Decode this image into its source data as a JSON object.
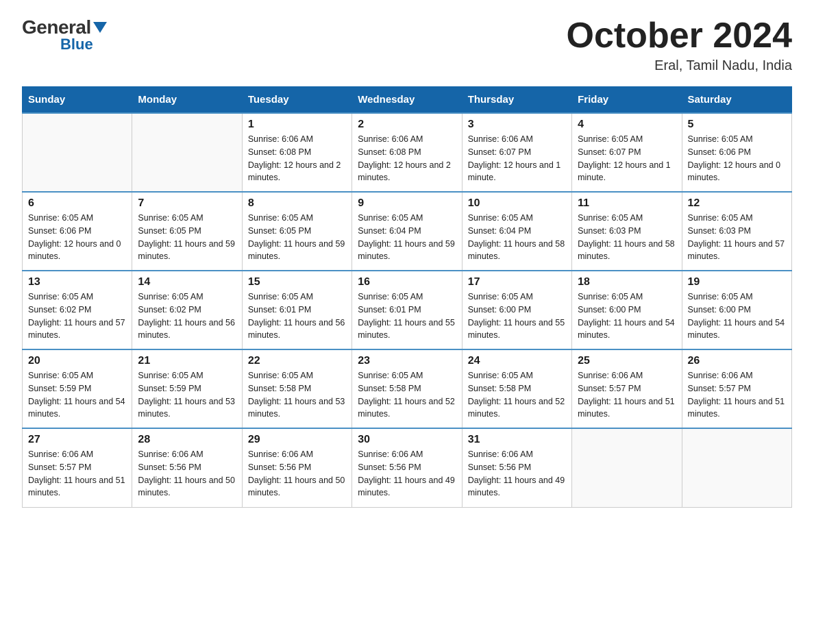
{
  "logo": {
    "general": "General",
    "blue": "Blue",
    "triangle": "▼"
  },
  "header": {
    "title": "October 2024",
    "subtitle": "Eral, Tamil Nadu, India"
  },
  "days_of_week": [
    "Sunday",
    "Monday",
    "Tuesday",
    "Wednesday",
    "Thursday",
    "Friday",
    "Saturday"
  ],
  "weeks": [
    [
      {
        "day": "",
        "sunrise": "",
        "sunset": "",
        "daylight": ""
      },
      {
        "day": "",
        "sunrise": "",
        "sunset": "",
        "daylight": ""
      },
      {
        "day": "1",
        "sunrise": "Sunrise: 6:06 AM",
        "sunset": "Sunset: 6:08 PM",
        "daylight": "Daylight: 12 hours and 2 minutes."
      },
      {
        "day": "2",
        "sunrise": "Sunrise: 6:06 AM",
        "sunset": "Sunset: 6:08 PM",
        "daylight": "Daylight: 12 hours and 2 minutes."
      },
      {
        "day": "3",
        "sunrise": "Sunrise: 6:06 AM",
        "sunset": "Sunset: 6:07 PM",
        "daylight": "Daylight: 12 hours and 1 minute."
      },
      {
        "day": "4",
        "sunrise": "Sunrise: 6:05 AM",
        "sunset": "Sunset: 6:07 PM",
        "daylight": "Daylight: 12 hours and 1 minute."
      },
      {
        "day": "5",
        "sunrise": "Sunrise: 6:05 AM",
        "sunset": "Sunset: 6:06 PM",
        "daylight": "Daylight: 12 hours and 0 minutes."
      }
    ],
    [
      {
        "day": "6",
        "sunrise": "Sunrise: 6:05 AM",
        "sunset": "Sunset: 6:06 PM",
        "daylight": "Daylight: 12 hours and 0 minutes."
      },
      {
        "day": "7",
        "sunrise": "Sunrise: 6:05 AM",
        "sunset": "Sunset: 6:05 PM",
        "daylight": "Daylight: 11 hours and 59 minutes."
      },
      {
        "day": "8",
        "sunrise": "Sunrise: 6:05 AM",
        "sunset": "Sunset: 6:05 PM",
        "daylight": "Daylight: 11 hours and 59 minutes."
      },
      {
        "day": "9",
        "sunrise": "Sunrise: 6:05 AM",
        "sunset": "Sunset: 6:04 PM",
        "daylight": "Daylight: 11 hours and 59 minutes."
      },
      {
        "day": "10",
        "sunrise": "Sunrise: 6:05 AM",
        "sunset": "Sunset: 6:04 PM",
        "daylight": "Daylight: 11 hours and 58 minutes."
      },
      {
        "day": "11",
        "sunrise": "Sunrise: 6:05 AM",
        "sunset": "Sunset: 6:03 PM",
        "daylight": "Daylight: 11 hours and 58 minutes."
      },
      {
        "day": "12",
        "sunrise": "Sunrise: 6:05 AM",
        "sunset": "Sunset: 6:03 PM",
        "daylight": "Daylight: 11 hours and 57 minutes."
      }
    ],
    [
      {
        "day": "13",
        "sunrise": "Sunrise: 6:05 AM",
        "sunset": "Sunset: 6:02 PM",
        "daylight": "Daylight: 11 hours and 57 minutes."
      },
      {
        "day": "14",
        "sunrise": "Sunrise: 6:05 AM",
        "sunset": "Sunset: 6:02 PM",
        "daylight": "Daylight: 11 hours and 56 minutes."
      },
      {
        "day": "15",
        "sunrise": "Sunrise: 6:05 AM",
        "sunset": "Sunset: 6:01 PM",
        "daylight": "Daylight: 11 hours and 56 minutes."
      },
      {
        "day": "16",
        "sunrise": "Sunrise: 6:05 AM",
        "sunset": "Sunset: 6:01 PM",
        "daylight": "Daylight: 11 hours and 55 minutes."
      },
      {
        "day": "17",
        "sunrise": "Sunrise: 6:05 AM",
        "sunset": "Sunset: 6:00 PM",
        "daylight": "Daylight: 11 hours and 55 minutes."
      },
      {
        "day": "18",
        "sunrise": "Sunrise: 6:05 AM",
        "sunset": "Sunset: 6:00 PM",
        "daylight": "Daylight: 11 hours and 54 minutes."
      },
      {
        "day": "19",
        "sunrise": "Sunrise: 6:05 AM",
        "sunset": "Sunset: 6:00 PM",
        "daylight": "Daylight: 11 hours and 54 minutes."
      }
    ],
    [
      {
        "day": "20",
        "sunrise": "Sunrise: 6:05 AM",
        "sunset": "Sunset: 5:59 PM",
        "daylight": "Daylight: 11 hours and 54 minutes."
      },
      {
        "day": "21",
        "sunrise": "Sunrise: 6:05 AM",
        "sunset": "Sunset: 5:59 PM",
        "daylight": "Daylight: 11 hours and 53 minutes."
      },
      {
        "day": "22",
        "sunrise": "Sunrise: 6:05 AM",
        "sunset": "Sunset: 5:58 PM",
        "daylight": "Daylight: 11 hours and 53 minutes."
      },
      {
        "day": "23",
        "sunrise": "Sunrise: 6:05 AM",
        "sunset": "Sunset: 5:58 PM",
        "daylight": "Daylight: 11 hours and 52 minutes."
      },
      {
        "day": "24",
        "sunrise": "Sunrise: 6:05 AM",
        "sunset": "Sunset: 5:58 PM",
        "daylight": "Daylight: 11 hours and 52 minutes."
      },
      {
        "day": "25",
        "sunrise": "Sunrise: 6:06 AM",
        "sunset": "Sunset: 5:57 PM",
        "daylight": "Daylight: 11 hours and 51 minutes."
      },
      {
        "day": "26",
        "sunrise": "Sunrise: 6:06 AM",
        "sunset": "Sunset: 5:57 PM",
        "daylight": "Daylight: 11 hours and 51 minutes."
      }
    ],
    [
      {
        "day": "27",
        "sunrise": "Sunrise: 6:06 AM",
        "sunset": "Sunset: 5:57 PM",
        "daylight": "Daylight: 11 hours and 51 minutes."
      },
      {
        "day": "28",
        "sunrise": "Sunrise: 6:06 AM",
        "sunset": "Sunset: 5:56 PM",
        "daylight": "Daylight: 11 hours and 50 minutes."
      },
      {
        "day": "29",
        "sunrise": "Sunrise: 6:06 AM",
        "sunset": "Sunset: 5:56 PM",
        "daylight": "Daylight: 11 hours and 50 minutes."
      },
      {
        "day": "30",
        "sunrise": "Sunrise: 6:06 AM",
        "sunset": "Sunset: 5:56 PM",
        "daylight": "Daylight: 11 hours and 49 minutes."
      },
      {
        "day": "31",
        "sunrise": "Sunrise: 6:06 AM",
        "sunset": "Sunset: 5:56 PM",
        "daylight": "Daylight: 11 hours and 49 minutes."
      },
      {
        "day": "",
        "sunrise": "",
        "sunset": "",
        "daylight": ""
      },
      {
        "day": "",
        "sunrise": "",
        "sunset": "",
        "daylight": ""
      }
    ]
  ]
}
